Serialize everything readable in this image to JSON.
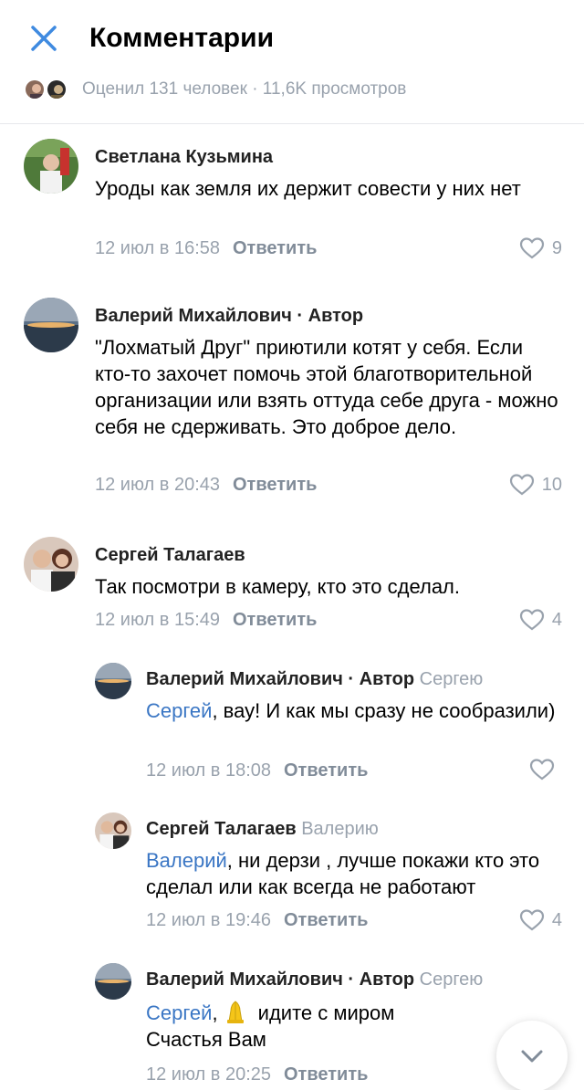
{
  "header": {
    "title": "Комментарии",
    "close_icon": "close-icon",
    "meta_text": "Оценил 131 человек · 11,6K просмотров"
  },
  "colors": {
    "accent": "#3a76c4",
    "secondary_text": "#99a2ad",
    "reply_link": "#818c99"
  },
  "comments": [
    {
      "name": "Светлана Кузьмина",
      "text": "Уроды как земля  их держит совести у них нет",
      "time": "12 июл в 16:58",
      "reply": "Ответить",
      "likes": "9"
    },
    {
      "name": "Валерий Михайлович",
      "author_tag": " · Автор",
      "text": "\"Лохматый Друг\" приютили котят у себя. Если кто-то захочет помочь этой благотворительной организации или взять оттуда себе друга - можно себя не сдерживать. Это доброе дело.",
      "time": "12 июл в 20:43",
      "reply": "Ответить",
      "likes": "10"
    },
    {
      "name": "Сергей Талагаев",
      "text": "Так посмотри в камеру, кто это сделал.",
      "time": "12 июл в 15:49",
      "reply": "Ответить",
      "likes": "4"
    },
    {
      "name": "Валерий Михайлович",
      "author_tag": " · Автор",
      "reply_to": " Сергею",
      "mention": "Сергей",
      "text": ", вау! И как мы сразу не сообразили)",
      "time": "12 июл в 18:08",
      "reply": "Ответить",
      "likes": ""
    },
    {
      "name": "Сергей Талагаев",
      "reply_to": " Валерию",
      "mention": "Валерий",
      "text": ", ни дерзи , лучше покажи кто это сделал или как всегда не работают",
      "time": "12 июл в 19:46",
      "reply": "Ответить",
      "likes": "4"
    },
    {
      "name": "Валерий Михайлович",
      "author_tag": " · Автор",
      "reply_to": " Сергею",
      "mention": "Сергей",
      "text_after_emoji": " идите с миром",
      "text_line2": "Счастья Вам",
      "emoji": "folded-hands-emoji",
      "time": "12 июл в 20:25",
      "reply": "Ответить"
    }
  ],
  "scroll_button_icon": "chevron-down-icon"
}
